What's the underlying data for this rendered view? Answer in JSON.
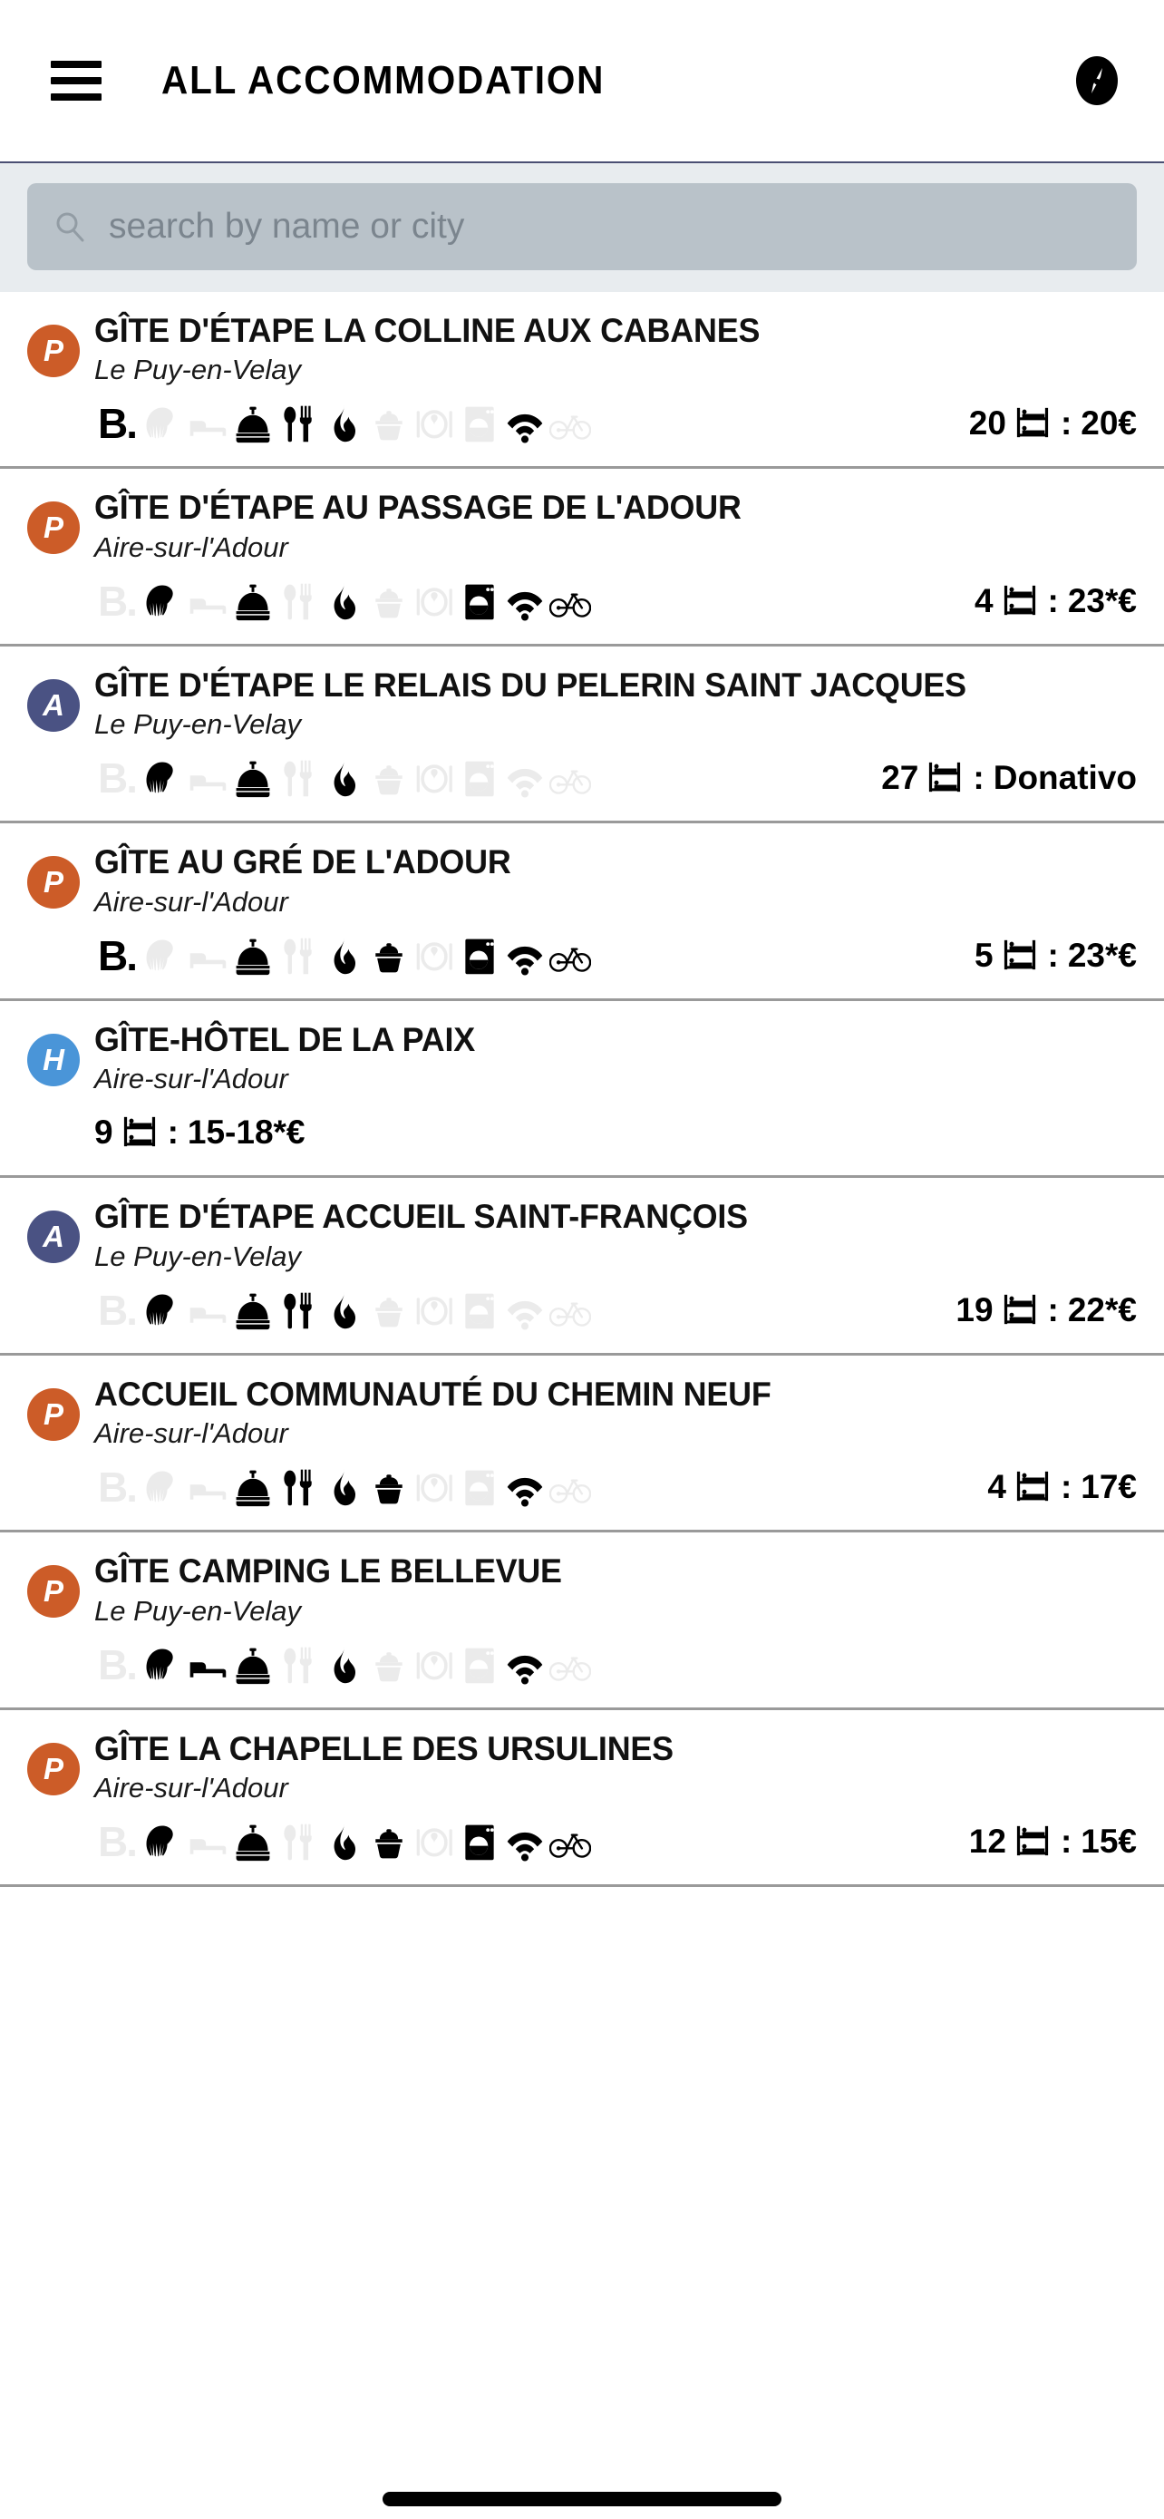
{
  "header": {
    "menu_icon": "hamburger-menu-icon",
    "title": "ALL ACCOMMODATION",
    "action_icon": "compass-icon"
  },
  "search": {
    "icon": "search-icon",
    "placeholder": "search by name or city",
    "value": ""
  },
  "colors": {
    "badge_private": "#cc5c28",
    "badge_association": "#4a5283",
    "badge_hotel": "#4a95d8",
    "search_field": "#b9c2c9",
    "search_band": "#e8ecef",
    "divider": "#9a9a9a",
    "icon_off": "#f0f0f0"
  },
  "amenity_order": [
    "booking",
    "shell",
    "bed",
    "bell",
    "cutlery",
    "flame",
    "pot",
    "plate",
    "washer",
    "wifi",
    "bike"
  ],
  "listings": [
    {
      "badge": "P",
      "badge_type": "private",
      "name": "GÎTE D'ÉTAPE LA COLLINE AUX CABANES",
      "city": "Le Puy-en-Velay",
      "beds": "20",
      "price": "20€",
      "separator": ":",
      "has_amenities": true,
      "has_price": true,
      "amenities": {
        "booking": true,
        "shell": false,
        "bed": false,
        "bell": true,
        "cutlery": true,
        "flame": true,
        "pot": false,
        "plate": false,
        "washer": false,
        "wifi": true,
        "bike": false
      }
    },
    {
      "badge": "P",
      "badge_type": "private",
      "name": "GÎTE D'ÉTAPE AU PASSAGE DE L'ADOUR",
      "city": "Aire-sur-l'Adour",
      "beds": "4",
      "price": "23*€",
      "separator": ":",
      "has_amenities": true,
      "has_price": true,
      "amenities": {
        "booking": false,
        "shell": true,
        "bed": false,
        "bell": true,
        "cutlery": false,
        "flame": true,
        "pot": false,
        "plate": false,
        "washer": true,
        "wifi": true,
        "bike": true
      }
    },
    {
      "badge": "A",
      "badge_type": "association",
      "name": "GÎTE D'ÉTAPE LE RELAIS DU PELERIN SAINT JACQUES",
      "city": "Le Puy-en-Velay",
      "beds": "27",
      "price": "Donativo",
      "separator": ":",
      "has_amenities": true,
      "has_price": true,
      "amenities": {
        "booking": false,
        "shell": true,
        "bed": false,
        "bell": true,
        "cutlery": false,
        "flame": true,
        "pot": false,
        "plate": false,
        "washer": false,
        "wifi": false,
        "bike": false
      }
    },
    {
      "badge": "P",
      "badge_type": "private",
      "name": "GÎTE AU GRÉ DE L'ADOUR",
      "city": "Aire-sur-l'Adour",
      "beds": "5",
      "price": "23*€",
      "separator": ":",
      "has_amenities": true,
      "has_price": true,
      "amenities": {
        "booking": true,
        "shell": false,
        "bed": false,
        "bell": true,
        "cutlery": false,
        "flame": true,
        "pot": true,
        "plate": false,
        "washer": true,
        "wifi": true,
        "bike": true
      }
    },
    {
      "badge": "H",
      "badge_type": "hotel",
      "name": "GÎTE-HÔTEL DE LA PAIX",
      "city": "Aire-sur-l'Adour",
      "beds": "9",
      "price": "15-18*€",
      "separator": ":",
      "has_amenities": false,
      "has_price": true,
      "amenities": {
        "booking": false,
        "shell": false,
        "bed": false,
        "bell": false,
        "cutlery": false,
        "flame": false,
        "pot": false,
        "plate": false,
        "washer": false,
        "wifi": false,
        "bike": false
      }
    },
    {
      "badge": "A",
      "badge_type": "association",
      "name": "GÎTE D'ÉTAPE ACCUEIL SAINT-FRANÇOIS",
      "city": "Le Puy-en-Velay",
      "beds": "19",
      "price": "22*€",
      "separator": ":",
      "has_amenities": true,
      "has_price": true,
      "amenities": {
        "booking": false,
        "shell": true,
        "bed": false,
        "bell": true,
        "cutlery": true,
        "flame": true,
        "pot": false,
        "plate": false,
        "washer": false,
        "wifi": false,
        "bike": false
      }
    },
    {
      "badge": "P",
      "badge_type": "private",
      "name": "ACCUEIL COMMUNAUTÉ DU CHEMIN NEUF",
      "city": "Aire-sur-l'Adour",
      "beds": "4",
      "price": "17€",
      "separator": ":",
      "has_amenities": true,
      "has_price": true,
      "amenities": {
        "booking": false,
        "shell": false,
        "bed": false,
        "bell": true,
        "cutlery": true,
        "flame": true,
        "pot": true,
        "plate": false,
        "washer": false,
        "wifi": true,
        "bike": false
      }
    },
    {
      "badge": "P",
      "badge_type": "private",
      "name": "GÎTE CAMPING LE BELLEVUE",
      "city": "Le Puy-en-Velay",
      "beds": "",
      "price": "",
      "separator": "",
      "has_amenities": true,
      "has_price": false,
      "amenities": {
        "booking": false,
        "shell": true,
        "bed": true,
        "bell": true,
        "cutlery": false,
        "flame": true,
        "pot": false,
        "plate": false,
        "washer": false,
        "wifi": true,
        "bike": false
      }
    },
    {
      "badge": "P",
      "badge_type": "private",
      "name": "GÎTE LA CHAPELLE DES URSULINES",
      "city": "Aire-sur-l'Adour",
      "beds": "12",
      "price": "15€",
      "separator": ":",
      "has_amenities": true,
      "has_price": true,
      "amenities": {
        "booking": false,
        "shell": true,
        "bed": false,
        "bell": true,
        "cutlery": false,
        "flame": true,
        "pot": true,
        "plate": false,
        "washer": true,
        "wifi": true,
        "bike": true
      }
    }
  ]
}
